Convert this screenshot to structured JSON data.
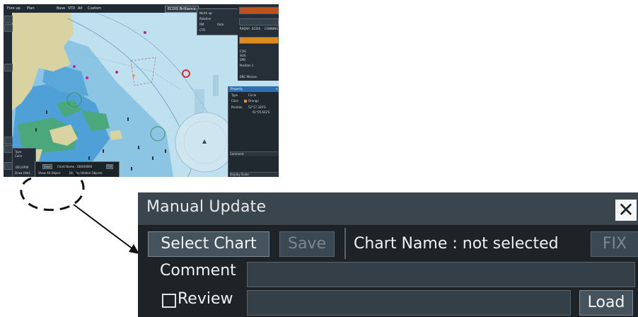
{
  "ecdis": {
    "topbar": [
      "Fore up",
      "Plan",
      "Base",
      "STD",
      "All",
      "Custom"
    ],
    "brilliance_label": "ECDIS Brilliance",
    "toppop": [
      "North up",
      "Relative",
      "RM",
      "Auto",
      "CTR"
    ],
    "rightpanel": [
      "RADAR",
      "ECDIS",
      "CONNING",
      "COG",
      "SOG",
      "SPD",
      "Position 1",
      "ENC Mission"
    ],
    "property": {
      "title": "Property",
      "type_label": "Type",
      "type_value": "Circle",
      "color_label": "Color",
      "color_value": "Orange",
      "position_label": "Position",
      "lat": "52°27.320'S",
      "lon": "61°05.642'E",
      "comment_label": "Comment",
      "display_scale_label": "Display Scale"
    },
    "toolbox": {
      "type_label": "Type",
      "color_label": "Color",
      "del_label": "DEL/VRM",
      "show_label": "Draw Hidd..."
    },
    "mini_dialog": {
      "save": "Save",
      "chart_name": "Chart Name : GB4X0000",
      "fix": "FIX",
      "show_all": "Show All Object",
      "display_hidden": "Display Hidden Objects"
    }
  },
  "dialog": {
    "title": "Manual Update",
    "close_icon": "close-icon",
    "select_chart": "Select Chart",
    "save": "Save",
    "chart_name": "Chart Name : not selected",
    "fix": "FIX",
    "comment_label": "Comment",
    "review_label": "Review",
    "load": "Load"
  },
  "colors": {
    "dialog_bg": "#1d2327",
    "title_bg": "#3a454e",
    "button_bg": "#46535d",
    "sea": "#b9dcec",
    "land": "#d8d2a0",
    "shallow": "#3f98d4",
    "drying": "#48a87a"
  }
}
